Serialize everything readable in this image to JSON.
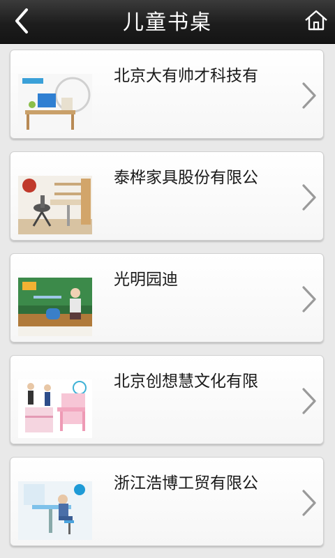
{
  "header": {
    "title": "儿童书桌",
    "back_icon": "back-chevron-icon",
    "home_icon": "home-icon"
  },
  "items": [
    {
      "name": "北京大有帅才科技有",
      "thumb": "desk-product-photo-1"
    },
    {
      "name": "泰桦家具股份有限公",
      "thumb": "desk-product-photo-2"
    },
    {
      "name": "光明园迪",
      "thumb": "desk-product-photo-3"
    },
    {
      "name": "北京创想慧文化有限",
      "thumb": "desk-product-photo-4"
    },
    {
      "name": "浙江浩博工贸有限公",
      "thumb": "desk-product-photo-5"
    }
  ],
  "colors": {
    "header_bg": "#1d1d1d",
    "page_bg": "#e9e9e9",
    "chevron": "#9a9a9a"
  }
}
